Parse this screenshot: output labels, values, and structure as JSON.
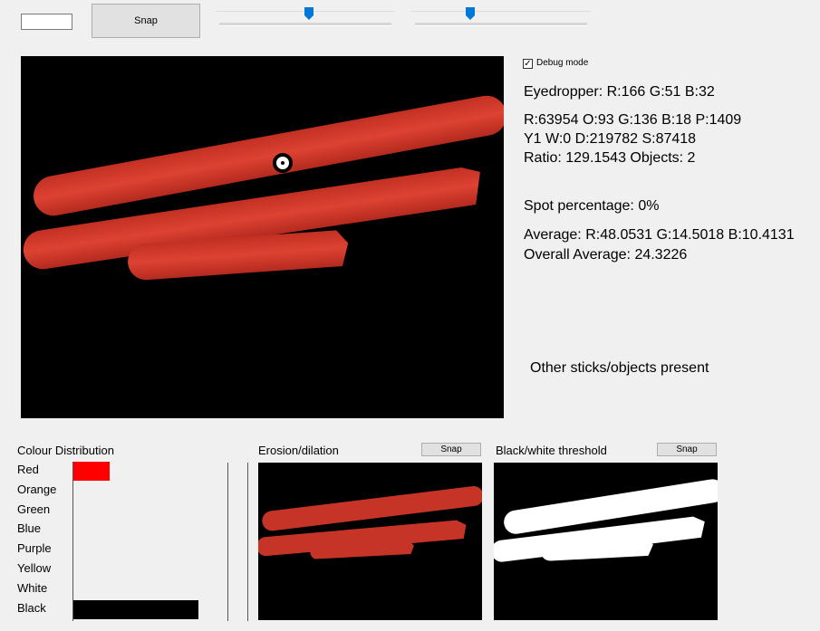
{
  "toolbar": {
    "text_value": "",
    "snap_label": "Snap",
    "slider1_value": 0.52,
    "slider2_value": 0.32
  },
  "debug": {
    "label": "Debug mode",
    "checked": true,
    "check_glyph": "✓"
  },
  "info": {
    "eyedropper": "Eyedropper: R:166 G:51 B:32",
    "counts_line1": "R:63954 O:93 G:136 B:18 P:1409",
    "counts_line2": "Y1 W:0 D:219782 S:87418",
    "ratio": "Ratio: 129.1543 Objects: 2",
    "spot": "Spot percentage: 0%",
    "average": "Average: R:48.0531 G:14.5018 B:10.4131",
    "overall": "Overall Average: 24.3226",
    "status": "Other sticks/objects present"
  },
  "colour_distribution": {
    "title": "Colour Distribution",
    "items": [
      {
        "label": "Red",
        "fraction": 0.29,
        "color": "#ff0000"
      },
      {
        "label": "Orange",
        "fraction": 0.0,
        "color": "#ff8000"
      },
      {
        "label": "Green",
        "fraction": 0.0,
        "color": "#00ff00"
      },
      {
        "label": "Blue",
        "fraction": 0.0,
        "color": "#0000ff"
      },
      {
        "label": "Purple",
        "fraction": 0.0,
        "color": "#800080"
      },
      {
        "label": "Yellow",
        "fraction": 0.0,
        "color": "#ffff00"
      },
      {
        "label": "White",
        "fraction": 0.0,
        "color": "#ffffff"
      },
      {
        "label": "Black",
        "fraction": 1.0,
        "color": "#000000"
      }
    ]
  },
  "erosion": {
    "title": "Erosion/dilation",
    "snap_label": "Snap"
  },
  "threshold": {
    "title": "Black/white threshold",
    "snap_label": "Snap"
  },
  "colors": {
    "stick": "#d63a2a",
    "view_bg": "#000000",
    "slider_thumb": "#0078d7"
  }
}
